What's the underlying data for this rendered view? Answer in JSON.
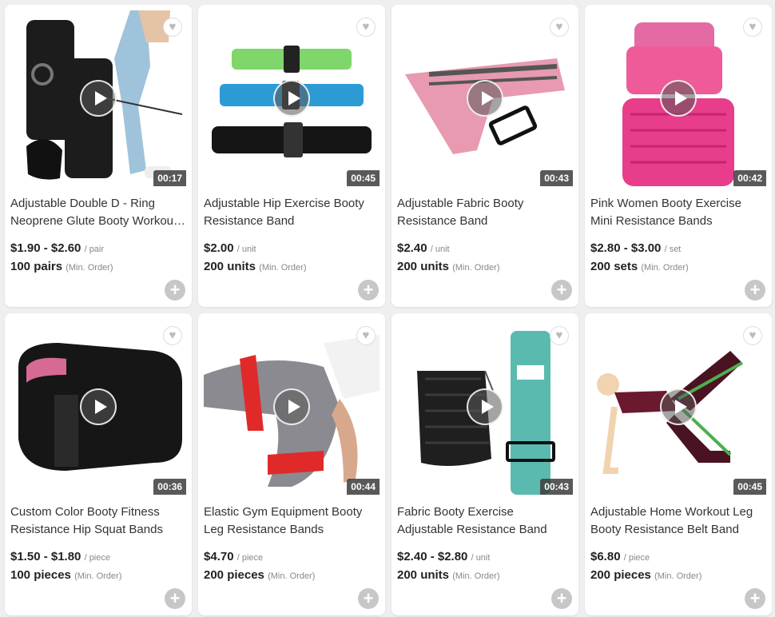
{
  "products": [
    {
      "title_line1": "Adjustable Double D - Ring",
      "title_line2": "Neoprene Glute Booty Workou…",
      "price": "$1.90 - $2.60",
      "unit": "/ pair",
      "moq": "100 pairs",
      "moq_note": "(Min. Order)",
      "duration": "00:17",
      "image_icon": "ankle-strap-image"
    },
    {
      "title_line1": "Adjustable Hip Exercise Booty",
      "title_line2": "Resistance Band",
      "price": "$2.00",
      "unit": "/ unit",
      "moq": "200 units",
      "moq_note": "(Min. Order)",
      "duration": "00:45",
      "image_icon": "hip-band-image"
    },
    {
      "title_line1": "Adjustable Fabric Booty",
      "title_line2": "Resistance Band",
      "price": "$2.40",
      "unit": "/ unit",
      "moq": "200 units",
      "moq_note": "(Min. Order)",
      "duration": "00:43",
      "image_icon": "fabric-band-image"
    },
    {
      "title_line1": "Pink Women Booty Exercise",
      "title_line2": "Mini Resistance Bands",
      "price": "$2.80 - $3.00",
      "unit": "/ set",
      "moq": "200 sets",
      "moq_note": "(Min. Order)",
      "duration": "00:42",
      "image_icon": "pink-bands-image"
    },
    {
      "title_line1": "Custom Color Booty Fitness",
      "title_line2": "Resistance Hip Squat Bands",
      "price": "$1.50 - $1.80",
      "unit": "/ piece",
      "moq": "100 pieces",
      "moq_note": "(Min. Order)",
      "duration": "00:36",
      "image_icon": "black-band-image"
    },
    {
      "title_line1": "Elastic Gym Equipment Booty",
      "title_line2": "Leg Resistance Bands",
      "price": "$4.70",
      "unit": "/ piece",
      "moq": "200 pieces",
      "moq_note": "(Min. Order)",
      "duration": "00:44",
      "image_icon": "leg-band-image"
    },
    {
      "title_line1": "Fabric Booty Exercise",
      "title_line2": "Adjustable Resistance Band",
      "price": "$2.40 - $2.80",
      "unit": "/ unit",
      "moq": "200 units",
      "moq_note": "(Min. Order)",
      "duration": "00:43",
      "image_icon": "teal-band-image"
    },
    {
      "title_line1": "Adjustable Home Workout Leg",
      "title_line2": "Booty Resistance Belt Band",
      "price": "$6.80",
      "unit": "/ piece",
      "moq": "200 pieces",
      "moq_note": "(Min. Order)",
      "duration": "00:45",
      "image_icon": "belt-band-image"
    }
  ],
  "icons": {
    "favorite": "heart-icon",
    "play": "play-icon",
    "add": "plus-icon"
  },
  "colors": {
    "card_bg": "#ffffff",
    "page_bg": "#efefef",
    "add_button": "#c7c7c7"
  }
}
